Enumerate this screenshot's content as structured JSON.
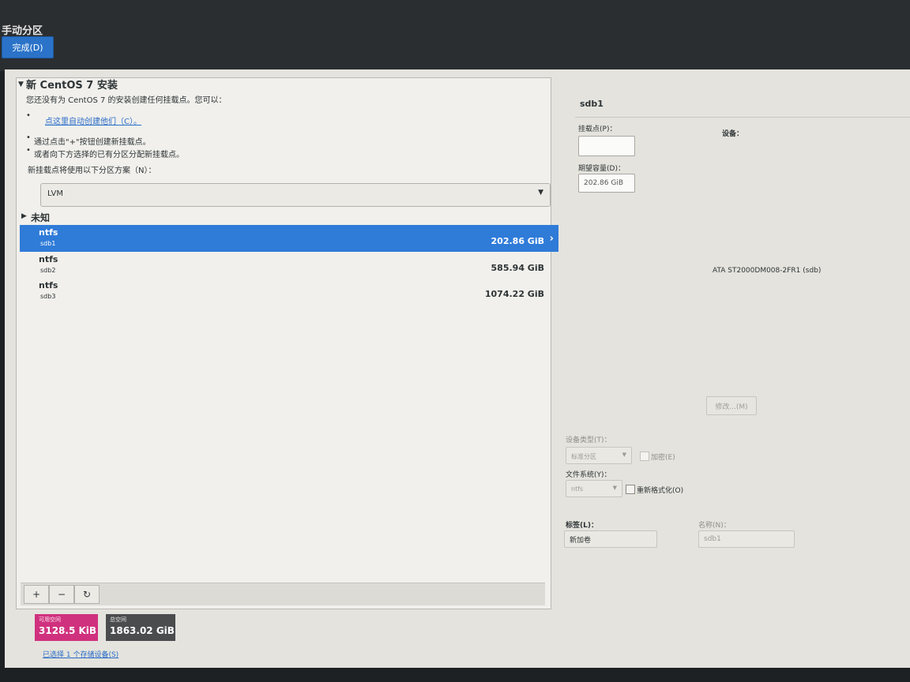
{
  "header": {
    "title": "手动分区",
    "done_label": "完成(D)"
  },
  "new_install": {
    "title": "新 CentOS 7 安装",
    "hint": "您还没有为 CentOS 7 的安装创建任何挂载点。您可以：",
    "auto_create_link": "点这里自动创建他们（C）。",
    "hint_plus": "通过点击\"+\"按钮创建新挂载点。",
    "hint_reassign": "或者向下方选择的已有分区分配新挂载点。",
    "scheme_label": "新挂载点将使用以下分区方案（N）：",
    "scheme_value": "LVM"
  },
  "unknown_group": {
    "title": "未知",
    "partitions": [
      {
        "fs": "ntfs",
        "device": "sdb1",
        "size": "202.86 GiB",
        "selected": true
      },
      {
        "fs": "ntfs",
        "device": "sdb2",
        "size": "585.94 GiB",
        "selected": false
      },
      {
        "fs": "ntfs",
        "device": "sdb3",
        "size": "1074.22 GiB",
        "selected": false
      }
    ]
  },
  "toolbar": {
    "add": "+",
    "remove": "−",
    "refresh": "↻"
  },
  "space": {
    "available_label": "可用空间",
    "available_value": "3128.5 KiB",
    "total_label": "总空间",
    "total_value": "1863.02 GiB",
    "storage_link": "已选择 1 个存储设备(S)"
  },
  "details": {
    "title": "sdb1",
    "mount_point_label": "挂载点(P)：",
    "mount_point_value": "",
    "desired_capacity_label": "期望容量(D)：",
    "desired_capacity_value": "202.86 GiB",
    "devices_label": "设备：",
    "device_name": "ATA ST2000DM008-2FR1 (sdb)",
    "modify_label": "修改...(M)",
    "device_type_label": "设备类型(T)：",
    "device_type_value": "标准分区",
    "encrypt_label": "加密(E)",
    "filesystem_label": "文件系统(Y)：",
    "filesystem_value": "ntfs",
    "reformat_label": "重新格式化(O)",
    "label_label": "标签(L)：",
    "label_value": "新加卷",
    "name_label": "名称(N)：",
    "name_value": "sdb1"
  }
}
